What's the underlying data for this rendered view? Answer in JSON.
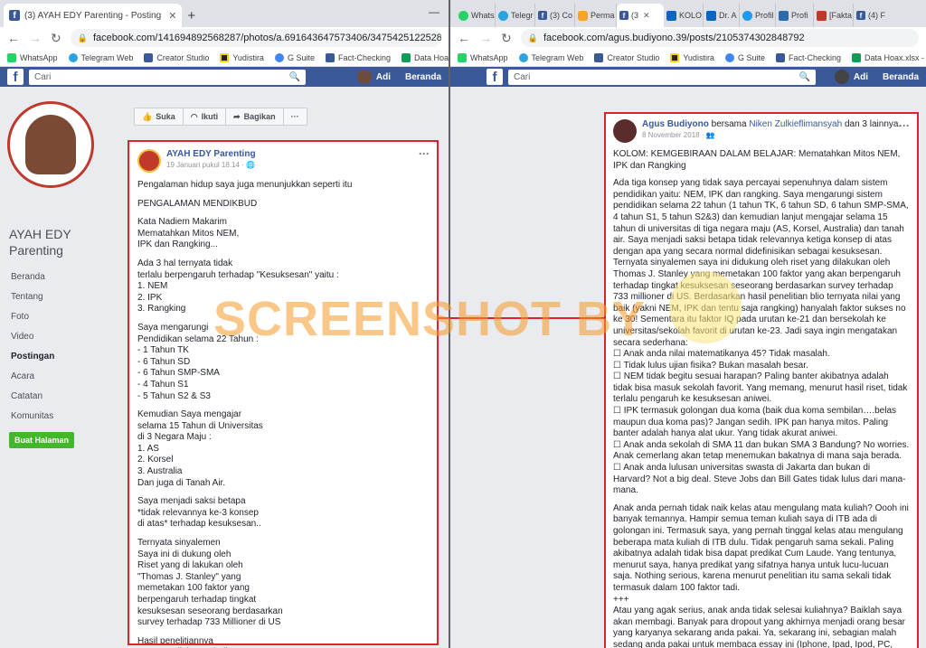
{
  "left": {
    "tab_title": "(3) AYAH EDY Parenting - Posting",
    "url": "facebook.com/141694892568287/photos/a.691643647573406/3475425122528564/?type...",
    "bookmarks": [
      "WhatsApp",
      "Telegram Web",
      "Creator Studio",
      "Yudistira",
      "G Suite",
      "Fact-Checking",
      "Data Hoax.xlsx"
    ],
    "search_placeholder": "Cari",
    "user_name": "Adi",
    "home_label": "Beranda",
    "page_name": "AYAH EDY Parenting",
    "menu": [
      "Beranda",
      "Tentang",
      "Foto",
      "Video",
      "Postingan",
      "Acara",
      "Catatan",
      "Komunitas"
    ],
    "create_page_button": "Buat Halaman",
    "actions": [
      "Suka",
      "Ikuti",
      "Bagikan",
      "···"
    ],
    "post": {
      "author": "AYAH EDY Parenting",
      "date": "19 Januari pukul 18.14 ·",
      "paragraphs": [
        "Pengalaman hidup saya juga menunjukkan seperti itu",
        "PENGALAMAN MENDIKBUD",
        "Kata Nadiem Makarim\nMematahkan Mitos NEM,\nIPK dan Rangking...",
        "Ada 3 hal ternyata tidak\nterlalu berpengaruh terhadap \"Kesuksesan\" yaitu :\n1. NEM\n2. IPK\n3. Rangking",
        "Saya mengarungi\nPendidikan selama 22 Tahun :\n- 1 Tahun TK\n- 6 Tahun SD\n- 6 Tahun SMP-SMA\n- 4 Tahun S1\n- 5 Tahun S2 & S3",
        "Kemudian Saya mengajar\nselama 15 Tahun di Universitas\ndi 3 Negara Maju :\n1. AS\n2. Korsel\n3. Australia\nDan juga di Tanah Air.",
        "Saya menjadi saksi betapa\n*tidak relevannya ke-3 konsep\ndi atas* terhadap kesuksesan..",
        "Ternyata sinyalemen\nSaya ini di dukung oleh\nRiset yang di lakukan oleh\n\"Thomas J. Stanley\" yang\nmemetakan 100 faktor yang\nberpengaruh terhadap tingkat\nkesuksesan seseorang berdasarkan\nsurvey terhadap 733 Millioner di US",
        "Hasil penelitiannya\nternyata nilai yang baik"
      ]
    }
  },
  "right": {
    "tabs": [
      "WhatsApp",
      "Telegr",
      "(3) Co",
      "Perma",
      "(3",
      "KOLO",
      "Dr. A",
      "Profil",
      "Profi",
      "[Fakta",
      "(4) F"
    ],
    "url": "facebook.com/agus.budiyono.39/posts/2105374302848792",
    "bookmarks": [
      "WhatsApp",
      "Telegram Web",
      "Creator Studio",
      "Yudistira",
      "G Suite",
      "Fact-Checking",
      "Data Hoax.xlsx - Goo"
    ],
    "search_placeholder": "Cari",
    "user_name": "Adi",
    "home_label": "Beranda",
    "post": {
      "author": "Agus Budiyono",
      "with_word": "bersama",
      "tagged": "Niken Zulkieflimansyah",
      "and_others": "dan 3 lainnya.",
      "date": "8 November 2018 ·",
      "paragraphs": [
        "KOLOM: KEMGEBIRAAN DALAM BELAJAR: Mematahkan Mitos NEM, IPK dan Rangking",
        "Ada tiga konsep yang tidak saya percayai sepenuhnya dalam sistem pendidikan yaitu: NEM, IPK dan rangking. Saya mengarungi sistem pendidikan selama 22 tahun (1 tahun TK, 6 tahun SD, 6 tahun SMP-SMA, 4 tahun S1, 5 tahun S2&3) dan kemudian lanjut mengajar selama 15 tahun di universitas di tiga negara maju (AS, Korsel, Australia) dan tanah air. Saya menjadi saksi betapa tidak relevannya ketiga konsep di atas dengan apa yang secara normal didefinisikan sebagai kesuksesan. Ternyata sinyalemen saya ini didukung oleh riset yang dilakukan oleh Thomas J. Stanley yang memetakan 100 faktor yang akan berpengaruh terhadap tingkat kesuksesan seseorang berdasarkan survey terhadap 733 millioner di US. Berdasarkan hasil penelitian blio ternyata nilai yang baik (yakni NEM, IPK dan tentu saja rangking) hanyalah faktor sukses no ke 30! Sementara itu faktor IQ pada urutan ke-21 dan bersekolah ke universitas/sekolah favorit di urutan ke-23. Jadi saya ingin mengatakan secara sederhana:\n☐ Anak anda nilai matematikanya 45? Tidak masalah.\n☐ Tidak lulus ujian fisika? Bukan masalah besar.\n☐ NEM tidak begitu sesuai harapan? Paling banter akibatnya adalah tidak bisa masuk sekolah favorit. Yang memang, menurut hasil riset, tidak terlalu pengaruh ke kesuksesan aniwei.\n☐ IPK termasuk golongan dua koma (baik dua koma sembilan….belas maupun dua koma pas)? Jangan sedih. IPK pan hanya mitos. Paling banter adalah hanya alat ukur. Yang tidak akurat aniwei.\n☐ Anak anda sekolah di SMA 11 dan bukan SMA 3 Bandung? No worries. Anak cemerlang akan tetap menemukan bakatnya di mana saja berada.\n☐ Anak anda lulusan universitas swasta di Jakarta dan bukan di Harvard? Not a big deal. Steve Jobs dan Bill Gates tidak lulus dari mana-mana.",
        "Anak anda pernah tidak naik kelas atau mengulang mata kuliah? Oooh ini banyak temannya. Hampir semua teman kuliah saya di ITB ada di golongan ini. Termasuk saya, yang pernah tinggal kelas atau mengulang beberapa mata kuliah di ITB dulu. Tidak pengaruh sama sekali. Paling akibatnya adalah tidak bisa dapat predikat Cum Laude. Yang tentunya, menurut saya, hanya predikat yang sifatnya hanya untuk lucu-lucuan saja. Nothing serious, karena menurut penelitian itu sama sekali tidak termasuk dalam 100 faktor tadi.\n+++\nAtau yang agak serius, anak anda tidak selesai kuliahnya? Baiklah saya akan membagi. Banyak para dropout yang akhirnya menjadi orang besar yang karyanya sekarang anda pakai. Ya, sekarang ini, sebagian malah sedang anda pakai untuk membaca essay ini (Iphone, Ipad, Ipod, PC, Macbook, Windows, OS, Oracle software... dsb). Mereka adalah orang-"
      ]
    }
  },
  "watermark_text": "SCREENSHOT BY",
  "colors": {
    "facebook_blue": "#3b5998",
    "highlight_red": "#e4202d",
    "watermark_orange": "#f79928"
  }
}
